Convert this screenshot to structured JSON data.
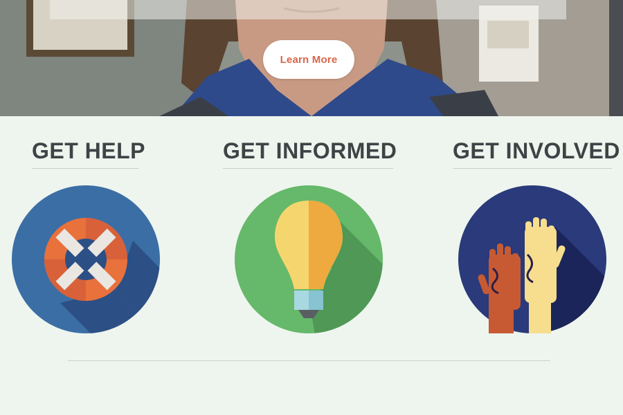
{
  "hero": {
    "button_label": "Learn More"
  },
  "sections": [
    {
      "title": "GET HELP",
      "icon": "life-ring-icon",
      "color": "#3b6ea5"
    },
    {
      "title": "GET INFORMED",
      "icon": "lightbulb-icon",
      "color": "#66b86a"
    },
    {
      "title": "GET INVOLVED",
      "icon": "raised-hands-icon",
      "color": "#2a3a7a"
    }
  ],
  "colors": {
    "background": "#eef5ee",
    "button_text": "#d8664a",
    "heading": "#3e4346"
  }
}
